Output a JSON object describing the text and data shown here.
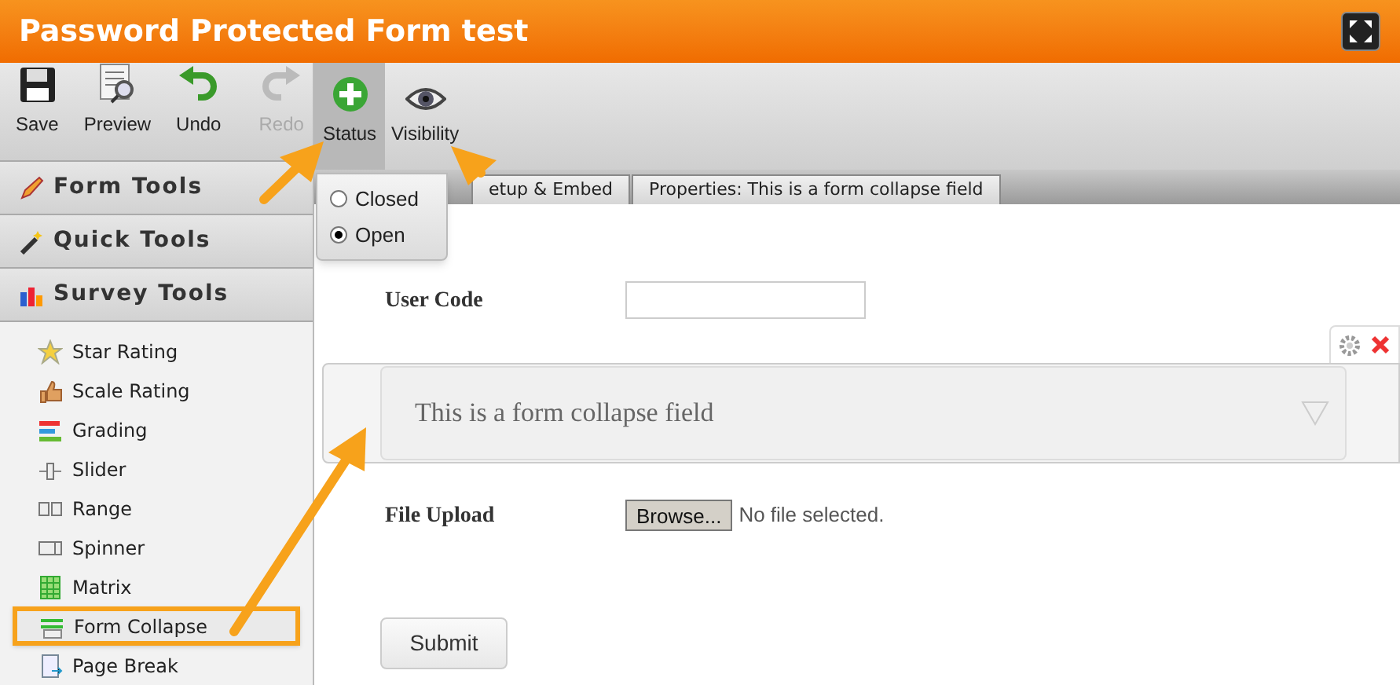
{
  "window": {
    "title": "Password Protected Form test"
  },
  "toolbar": [
    {
      "label": "Save",
      "disabled": false,
      "selected": false
    },
    {
      "label": "Preview",
      "disabled": false,
      "selected": false
    },
    {
      "label": "Undo",
      "disabled": false,
      "selected": false
    },
    {
      "label": "Redo",
      "disabled": true,
      "selected": false
    },
    {
      "label": "Status",
      "disabled": false,
      "selected": true
    },
    {
      "label": "Visibility",
      "disabled": false,
      "selected": false
    }
  ],
  "status_menu": [
    {
      "label": "Closed",
      "selected": false
    },
    {
      "label": "Open",
      "selected": true
    }
  ],
  "sidebar": {
    "sections": [
      {
        "label": "Form Tools"
      },
      {
        "label": "Quick Tools"
      },
      {
        "label": "Survey Tools"
      }
    ],
    "items": [
      {
        "label": "Star Rating",
        "highlighted": false
      },
      {
        "label": "Scale Rating",
        "highlighted": false
      },
      {
        "label": "Grading",
        "highlighted": false
      },
      {
        "label": "Slider",
        "highlighted": false
      },
      {
        "label": "Range",
        "highlighted": false
      },
      {
        "label": "Spinner",
        "highlighted": false
      },
      {
        "label": "Matrix",
        "highlighted": false
      },
      {
        "label": "Form Collapse",
        "highlighted": true
      },
      {
        "label": "Page Break",
        "highlighted": false
      }
    ]
  },
  "tabs": [
    {
      "label": "etup & Embed"
    },
    {
      "label": "Properties: This is a form collapse field"
    }
  ],
  "form": [
    {
      "kind": "text",
      "label": "User Code"
    },
    {
      "kind": "collapse",
      "label": "This is a form collapse field"
    },
    {
      "kind": "file",
      "label": "File Upload",
      "button": "Browse...",
      "value": "No file selected."
    },
    {
      "kind": "submit",
      "label": "Submit"
    }
  ]
}
